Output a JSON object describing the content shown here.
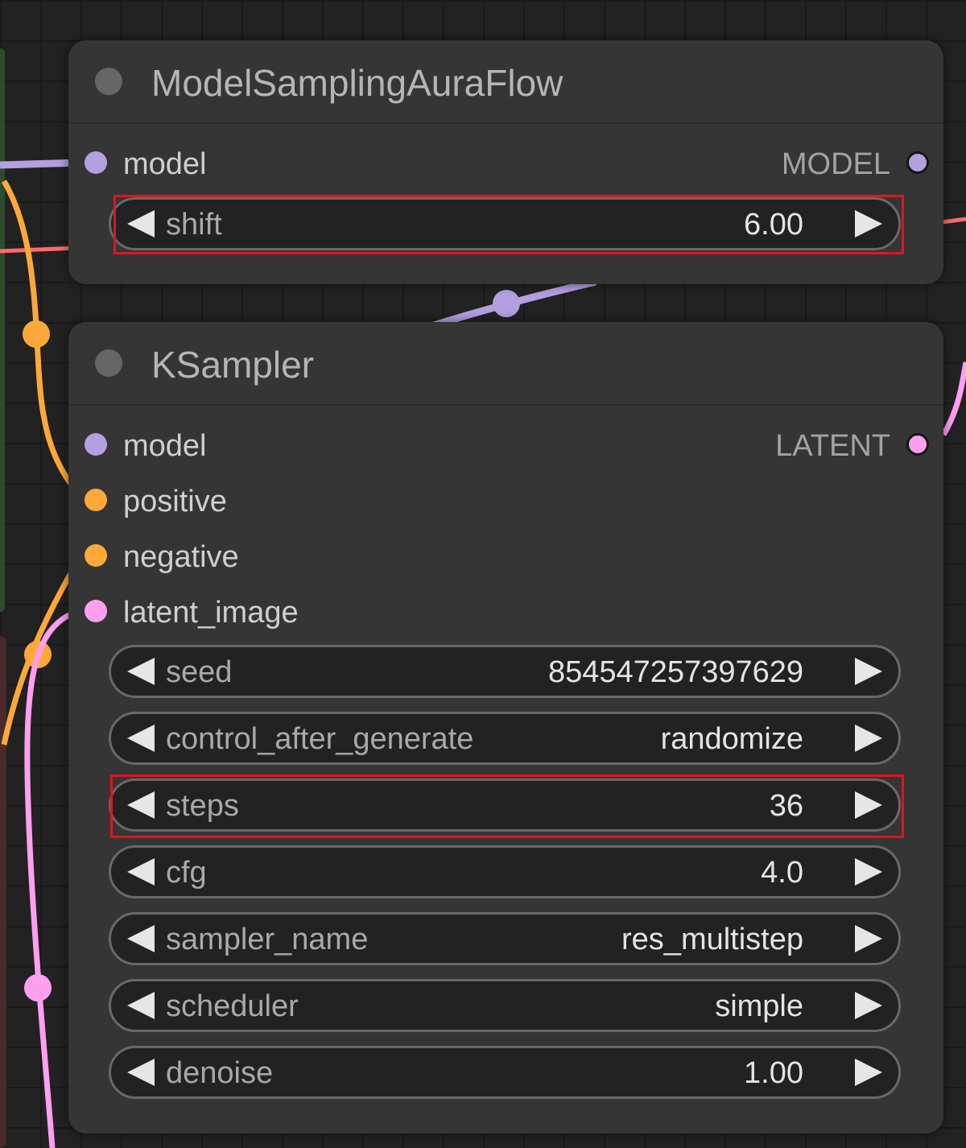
{
  "colors": {
    "model": "#b3a0e0",
    "conditioning": "#ffa83a",
    "latent": "#ff9ff0",
    "highlight": "#e0141e"
  },
  "nodes": {
    "model_sampling": {
      "title": "ModelSamplingAuraFlow",
      "inputs": [
        {
          "label": "model",
          "type": "model"
        }
      ],
      "output": {
        "label": "MODEL",
        "type": "model"
      },
      "widgets": [
        {
          "label": "shift",
          "value": "6.00"
        }
      ]
    },
    "ksampler": {
      "title": "KSampler",
      "inputs": [
        {
          "label": "model",
          "type": "model"
        },
        {
          "label": "positive",
          "type": "conditioning"
        },
        {
          "label": "negative",
          "type": "conditioning"
        },
        {
          "label": "latent_image",
          "type": "latent"
        }
      ],
      "output": {
        "label": "LATENT",
        "type": "latent"
      },
      "widgets": [
        {
          "label": "seed",
          "value": "854547257397629"
        },
        {
          "label": "control_after_generate",
          "value": "randomize"
        },
        {
          "label": "steps",
          "value": "36"
        },
        {
          "label": "cfg",
          "value": "4.0"
        },
        {
          "label": "sampler_name",
          "value": "res_multistep"
        },
        {
          "label": "scheduler",
          "value": "simple"
        },
        {
          "label": "denoise",
          "value": "1.00"
        }
      ]
    }
  }
}
